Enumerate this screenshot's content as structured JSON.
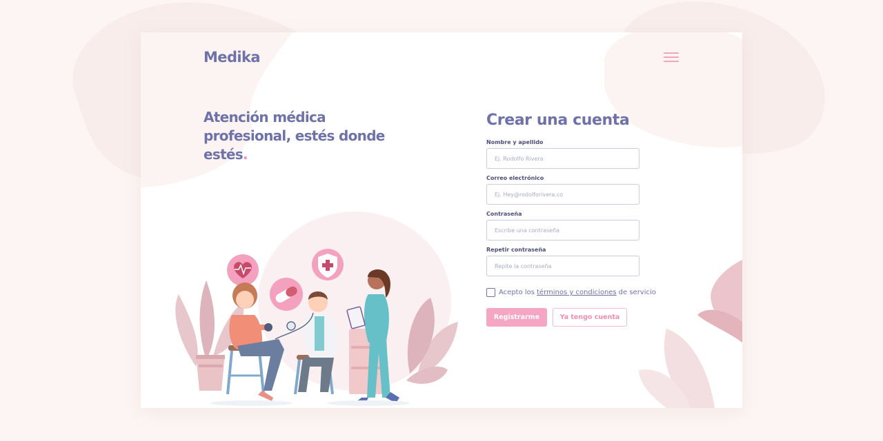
{
  "brand": {
    "name": "Medika"
  },
  "hero": {
    "title": "Atención médica profesional, estés donde estés",
    "title_dot": "."
  },
  "form": {
    "title": "Crear una cuenta",
    "fields": [
      {
        "label": "Nombre y apellido",
        "placeholder": "Ej. Rodolfo Rivera",
        "value": ""
      },
      {
        "label": "Correo electrónico",
        "placeholder": "Ej. Hey@rodolforivera.co",
        "value": ""
      },
      {
        "label": "Contraseña",
        "placeholder": "Escribe una contraseña",
        "value": ""
      },
      {
        "label": "Repetir contraseña",
        "placeholder": "Repite la contraseña",
        "value": ""
      }
    ],
    "terms": {
      "prefix": "Acepto los",
      "link": "términos y condiciones",
      "suffix": "de servicio",
      "checked": false
    },
    "primary_button": "Registrarme",
    "secondary_button": "Ya tengo cuenta"
  },
  "menu": {
    "icon": "hamburger-menu-icon"
  },
  "colors": {
    "brand": "#6e72a8",
    "accent_pink": "#f4a6c2",
    "page_bg": "#fcf5f3",
    "card_bg": "#ffffff"
  }
}
